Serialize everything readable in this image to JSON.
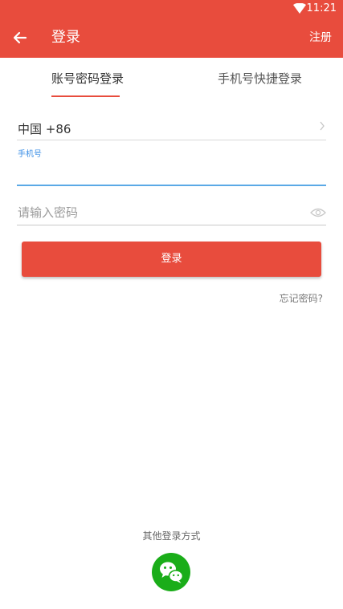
{
  "status_bar": {
    "time": "11:21"
  },
  "toolbar": {
    "title": "登录",
    "action_label": "注册"
  },
  "tabs": [
    {
      "label": "账号密码登录",
      "selected": true
    },
    {
      "label": "手机号快捷登录",
      "selected": false
    }
  ],
  "form": {
    "country_code": "中国 +86",
    "phone_label": "手机号",
    "phone_value": "",
    "password_placeholder": "请输入密码"
  },
  "login_button": {
    "label": "登录"
  },
  "forgot_password": "忘记密码?",
  "other_login": {
    "title": "其他登录方式",
    "icon": "wechat-icon"
  },
  "colors": {
    "primary": "#e84c3d",
    "focus": "#5aa9e6",
    "wechat": "#1aad19"
  }
}
